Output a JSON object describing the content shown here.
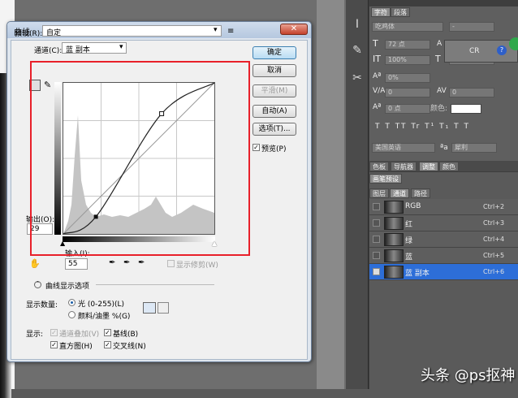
{
  "dialog": {
    "title": "曲线",
    "close": "✕",
    "preset_label": "预设(R):",
    "preset_value": "自定",
    "channel_label": "通道(C):",
    "channel_value": "蓝 副本",
    "output_label": "输出(O):",
    "output_value": "29",
    "input_label": "输入(I):",
    "input_value": "55",
    "show_clipping": "显示修剪(W)",
    "curve_options": "曲线显示选项",
    "show_amount_label": "显示数量:",
    "opt_light": "光 (0-255)(L)",
    "opt_pigment": "颜料/油墨 %(G)",
    "show_label": "显示:",
    "opt_channel_overlay": "通道叠加(V)",
    "opt_baseline": "基线(B)",
    "opt_histogram": "直方图(H)",
    "opt_intersection": "交叉线(N)",
    "buttons": {
      "ok": "确定",
      "cancel": "取消",
      "smooth": "平滑(M)",
      "auto": "自动(A)",
      "options": "选项(T)...",
      "preview": "预览(P)"
    },
    "checked": {
      "preview": true,
      "channel_overlay": true,
      "baseline": true,
      "histogram": true,
      "intersection": true,
      "show_clipping": false
    }
  },
  "curve_points": [
    [
      0,
      0
    ],
    [
      55,
      29
    ],
    [
      166,
      203
    ],
    [
      255,
      255
    ]
  ],
  "char_panel": {
    "tabs": [
      "字符",
      "段落"
    ],
    "font_family": "吃鸡体",
    "font_style": "-",
    "font_size": "72 点",
    "scale_v": "100%",
    "tracking": "0",
    "baseline_pct": "0%",
    "kerning": "0",
    "baseline_shift": "0 点",
    "color_label": "颜色:",
    "language": "美国英语",
    "aa_label": "ªa",
    "aa_value": "犀利",
    "scale_h": "100%",
    "leading": "",
    "style_glyphs": "T T TT Tr T¹ T₁ T T"
  },
  "mini_window": {
    "text": "CR"
  },
  "mid_tabs": [
    "色板",
    "导航器",
    "调整",
    "颜色"
  ],
  "brush_tab": "画笔预设",
  "channels_tabs": [
    "图层",
    "通道",
    "路径"
  ],
  "channels": [
    {
      "name": "RGB",
      "key": "Ctrl+2",
      "visible": false,
      "selected": false
    },
    {
      "name": "红",
      "key": "Ctrl+3",
      "visible": false,
      "selected": false
    },
    {
      "name": "绿",
      "key": "Ctrl+4",
      "visible": false,
      "selected": false
    },
    {
      "name": "蓝",
      "key": "Ctrl+5",
      "visible": false,
      "selected": false
    },
    {
      "name": "蓝 副本",
      "key": "Ctrl+6",
      "visible": true,
      "selected": true
    }
  ],
  "watermark": "头条 @ps抠神",
  "colors": {
    "selection": "#2d6ed8",
    "highlight_box": "#e8202a"
  }
}
